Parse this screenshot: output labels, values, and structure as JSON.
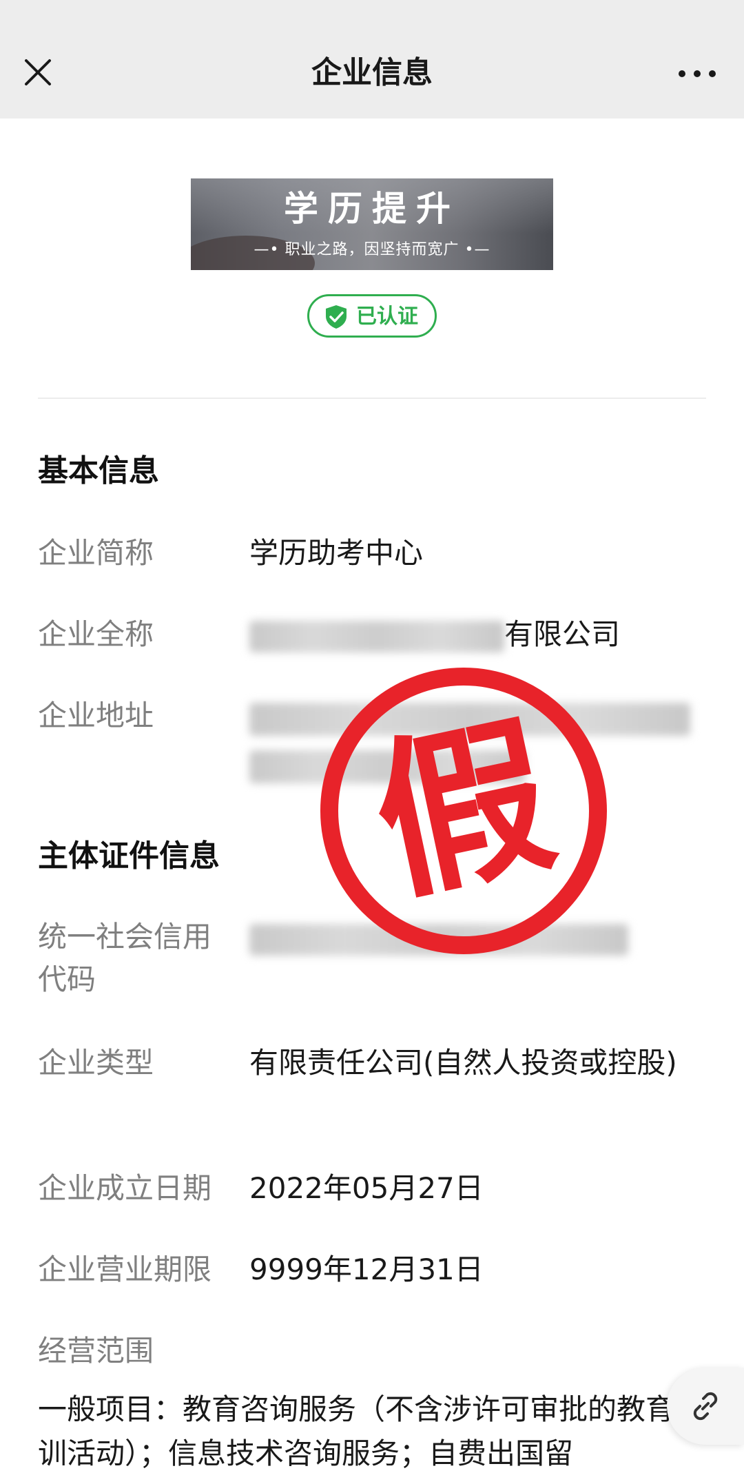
{
  "header": {
    "title": "企业信息"
  },
  "banner": {
    "title": "学历提升",
    "subtitle": "—• 职业之路，因坚持而宽广 •—"
  },
  "badge": {
    "label": "已认证"
  },
  "basic_info": {
    "section_title": "基本信息",
    "short_name_label": "企业简称",
    "short_name_value": "学历助考中心",
    "full_name_label": "企业全称",
    "full_name_visible_suffix": "有限公司",
    "address_label": "企业地址"
  },
  "license_info": {
    "section_title": "主体证件信息",
    "credit_code_label": "统一社会信用代码",
    "type_label": "企业类型",
    "type_value": "有限责任公司(自然人投资或控股)",
    "founded_label": "企业成立日期",
    "founded_value": "2022年05月27日",
    "term_label": "企业营业期限",
    "term_value": "9999年12月31日",
    "scope_label": "经营范围",
    "scope_value": "一般项目：教育咨询服务（不含涉许可审批的教育培训活动）；信息技术咨询服务；自费出国留"
  },
  "stamp": {
    "text": "假",
    "color": "#e8232a"
  },
  "colors": {
    "accent_green": "#2fae4f",
    "topbar_bg": "#ededed",
    "label_gray": "#7f7f7f"
  },
  "icons": {
    "close": "close-icon",
    "more": "more-dots-icon",
    "shield": "shield-check-icon",
    "link": "link-icon"
  }
}
